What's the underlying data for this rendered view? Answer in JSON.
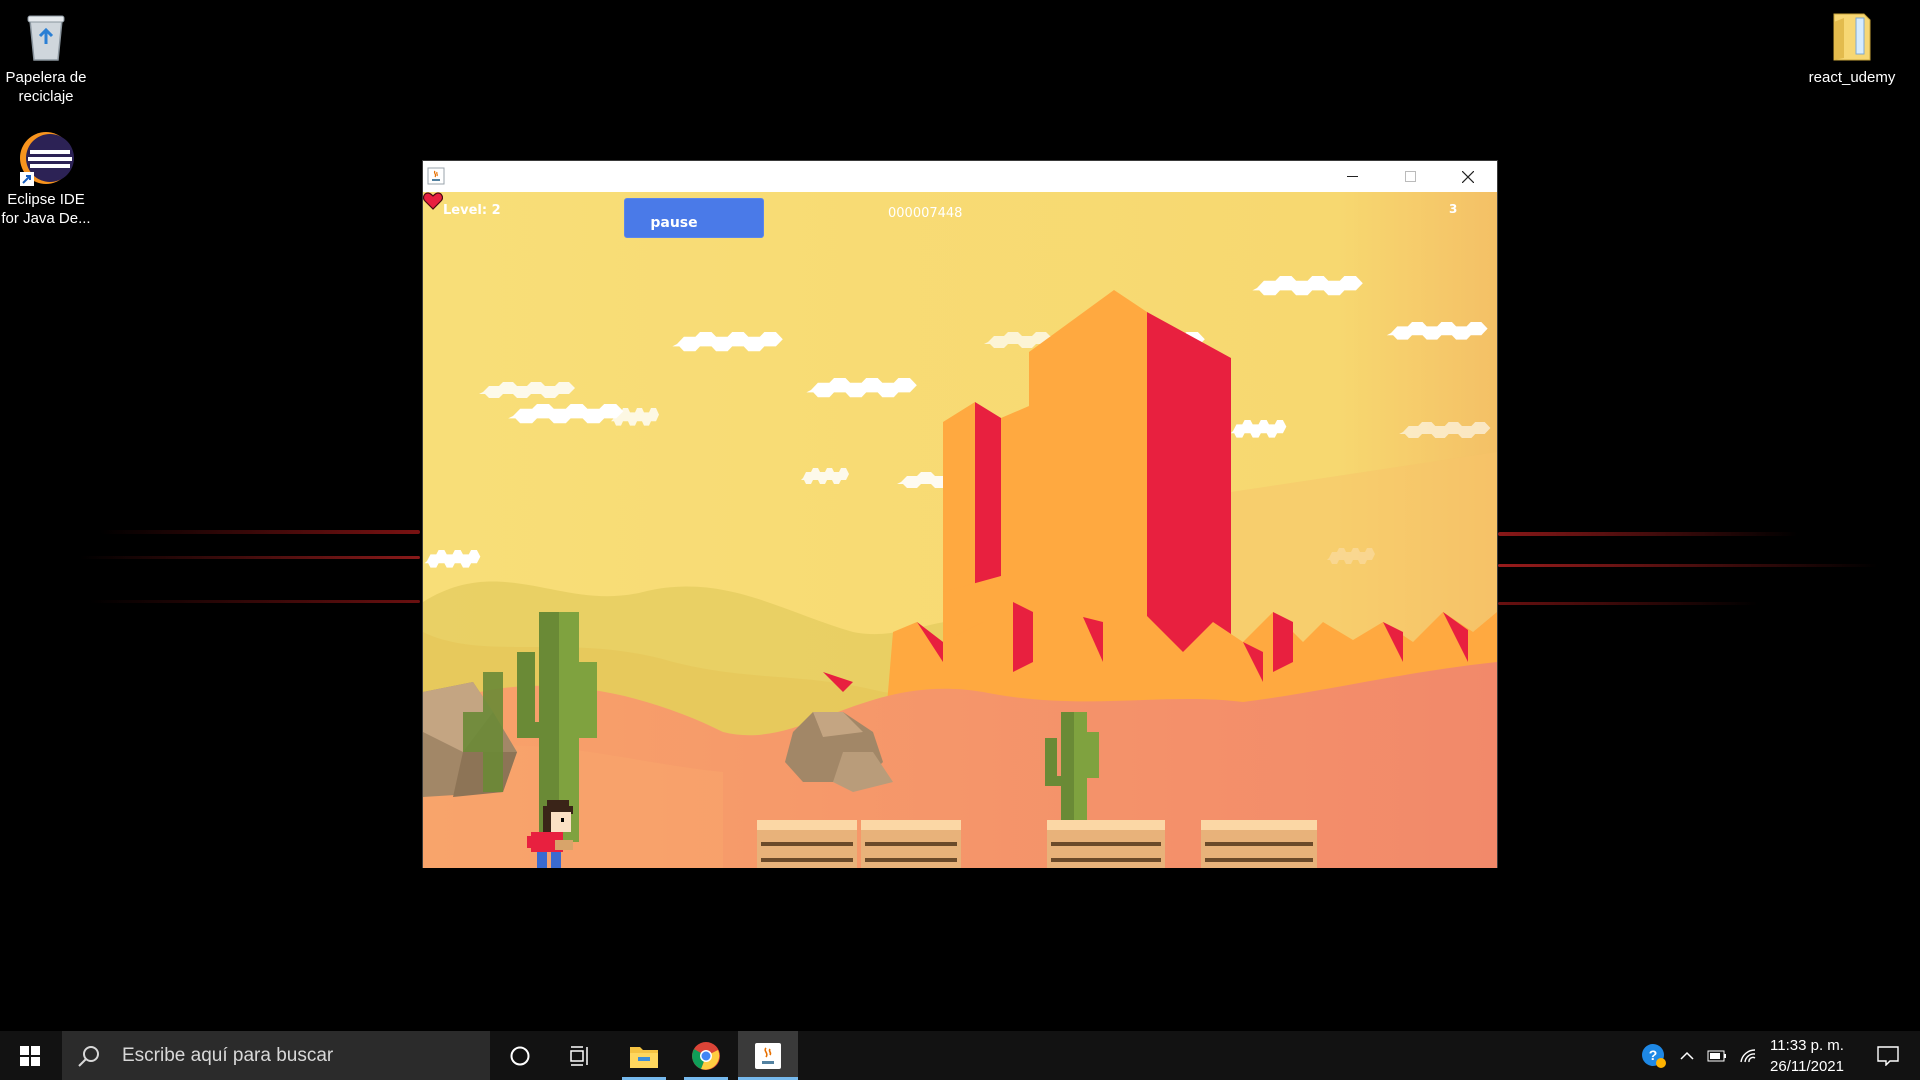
{
  "desktop": {
    "icons": [
      {
        "label": "Papelera de reciclaje",
        "icon": "recycle-bin-icon"
      },
      {
        "label": "Eclipse IDE for Java De...",
        "icon": "eclipse-icon"
      },
      {
        "label": "react_udemy",
        "icon": "folder-icon"
      }
    ]
  },
  "window": {
    "title": "",
    "app_icon": "java-icon",
    "controls": {
      "minimize": "minimize-icon",
      "maximize": "maximize-icon",
      "close": "close-icon"
    }
  },
  "game": {
    "level_text": "Level: 2",
    "pause_label": "pause",
    "score": "000007448",
    "lives": "3",
    "colors": {
      "sky": "#f7dc72",
      "mesa_orange": "#ffa940",
      "mesa_red": "#e8203f",
      "ground": "#f59a68",
      "pause_button": "#4a7ae8"
    }
  },
  "taskbar": {
    "search_placeholder": "Escribe aquí para buscar",
    "time": "11:33 p. m.",
    "date": "26/11/2021",
    "pinned": [
      "file-explorer-icon",
      "chrome-icon",
      "java-icon"
    ],
    "accent": "#76b9ed"
  }
}
